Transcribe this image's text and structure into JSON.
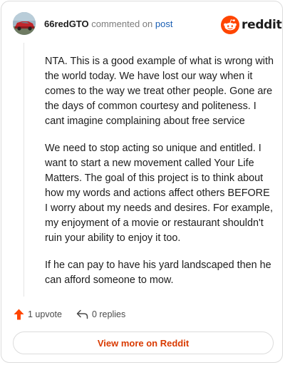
{
  "comment": {
    "username": "66redGTO",
    "action_text": "commented on",
    "post_link_label": "post",
    "paragraphs": [
      "NTA. This is a good example of what is wrong with the world today. We have lost our way when it comes to the way we treat other people. Gone are the days of common courtesy and politeness. I cant imagine complaining about free service",
      "We need to stop acting so unique and entitled. I want to start a new movement called Your Life Matters. The goal of this project is to think about how my words and actions affect others BEFORE I worry about my needs and desires. For example, my enjoyment of a movie or restaurant shouldn't ruin your ability to enjoy it too.",
      "If he can pay to have his yard landscaped then he can afford someone to mow."
    ]
  },
  "brand": {
    "name": "reddit",
    "logo_icon": "reddit-snoo-icon",
    "accent_color": "#ff4500"
  },
  "actions": {
    "upvote_label": "1 upvote",
    "upvote_icon": "upvote-arrow-icon",
    "upvote_color": "#ff4500",
    "replies_label": "0 replies",
    "replies_icon": "reply-arrow-icon"
  },
  "footer": {
    "view_button_label": "View more on Reddit",
    "button_color": "#d93a00"
  }
}
